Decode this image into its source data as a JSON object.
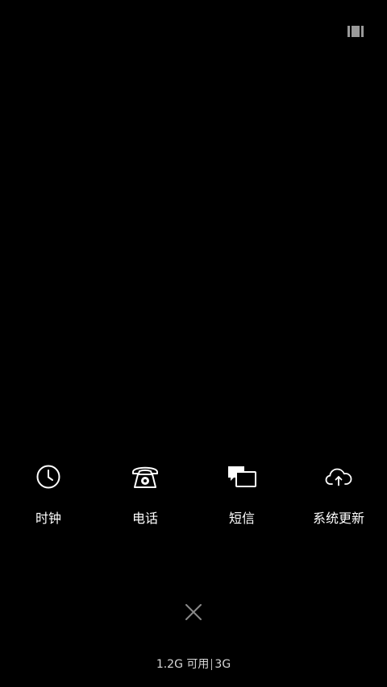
{
  "apps": [
    {
      "label": "时钟",
      "icon": "clock-icon"
    },
    {
      "label": "电话",
      "icon": "phone-icon"
    },
    {
      "label": "短信",
      "icon": "message-icon"
    },
    {
      "label": "系统更新",
      "icon": "cloud-upload-icon"
    }
  ],
  "memory": {
    "available": "1.2G 可用",
    "total": "3G"
  },
  "colors": {
    "background": "#000000",
    "foreground": "#ffffff",
    "muted": "#d8d8d8",
    "close": "#8a8a8a"
  },
  "icons": {
    "top_right": "view-toggle-icon",
    "close": "close-icon"
  }
}
